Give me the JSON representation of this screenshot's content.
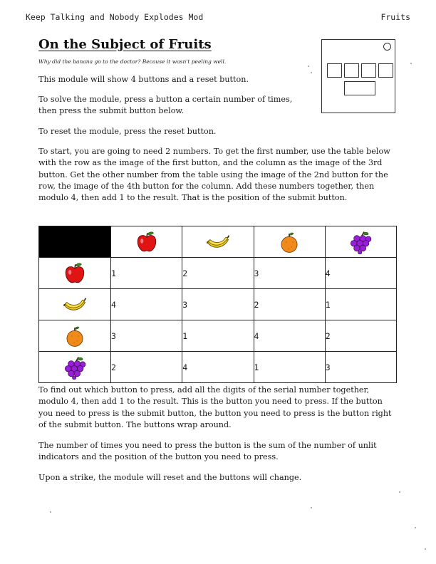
{
  "header": {
    "left": "Keep Talking and Nobody Explodes Mod",
    "right": "Fruits"
  },
  "title": "On the Subject of Fruits",
  "tagline": "Why did the banana go to the doctor? Because it wasn't peeling well.",
  "paragraphs": {
    "p1": "This module will show 4 buttons and a reset button.",
    "p2": "To solve the module, press a button a certain number of times, then press the submit button below.",
    "p3": "To reset the module, press the reset button.",
    "p4": "To start, you are going to need 2 numbers. To get the first number, use the table below with the row as the image of the first button, and the column as the image of the 3rd button. Get the other number from the table using the image of the 2nd button for the row, the image of the 4th button for the column. Add these numbers together, then modulo 4, then add 1 to the result. That is the position of the submit button.",
    "p5": "To find out which button to press, add all the digits of the serial number together, modulo 4, then add 1 to the result. This is the button you need to press. If the button you need to press is the submit button, the button you need to press is the button right of the submit button. The buttons wrap around.",
    "p6": "The number of times you need to press the button is the sum of the number of unlit indicators and the position of the button you need to press.",
    "p7": "Upon a strike, the module will reset and the buttons will change."
  },
  "table": {
    "columns": [
      "apple-icon",
      "banana-icon",
      "orange-icon",
      "grapes-icon"
    ],
    "rows": [
      {
        "icon": "apple-icon",
        "values": [
          "1",
          "2",
          "3",
          "4"
        ]
      },
      {
        "icon": "banana-icon",
        "values": [
          "4",
          "3",
          "2",
          "1"
        ]
      },
      {
        "icon": "orange-icon",
        "values": [
          "3",
          "1",
          "4",
          "2"
        ]
      },
      {
        "icon": "grapes-icon",
        "values": [
          "2",
          "4",
          "1",
          "3"
        ]
      }
    ]
  },
  "colors": {
    "apple": "#e01414",
    "banana": "#f2d21c",
    "orange": "#f08a1a",
    "grapes": "#9a1ed8",
    "leaf": "#3a8a1e"
  }
}
